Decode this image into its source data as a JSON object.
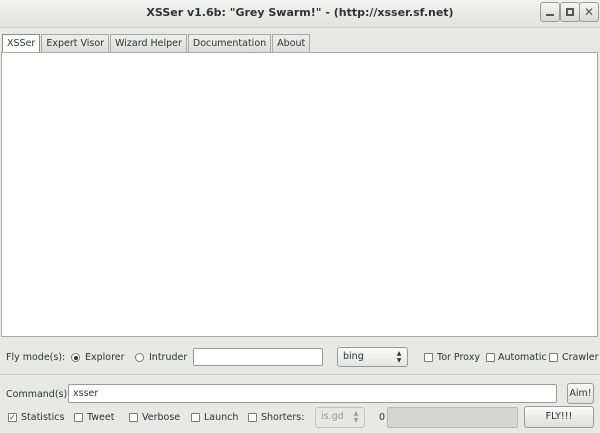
{
  "window": {
    "title": "XSSer v1.6b: \"Grey Swarm!\" - (http://xsser.sf.net)"
  },
  "tabs": [
    {
      "label": "XSSer",
      "active": true
    },
    {
      "label": "Expert Visor"
    },
    {
      "label": "Wizard Helper"
    },
    {
      "label": "Documentation"
    },
    {
      "label": "About"
    }
  ],
  "fly_mode": {
    "label": "Fly mode(s):",
    "explorer": {
      "label": "Explorer",
      "selected": true
    },
    "intruder": {
      "label": "Intruder",
      "selected": false
    },
    "target_value": "",
    "engine": "bing",
    "tor_proxy": "Tor Proxy",
    "automatic": "Automatic",
    "crawler": "Crawler"
  },
  "command": {
    "label": "Command(s):",
    "value": "xsser",
    "aim_button": "Aim!"
  },
  "options": {
    "statistics": {
      "label": "Statistics",
      "checked": true
    },
    "tweet": {
      "label": "Tweet",
      "checked": false
    },
    "verbose": {
      "label": "Verbose",
      "checked": false
    },
    "launch": {
      "label": "Launch",
      "checked": false
    },
    "shorters": {
      "label": "Shorters:",
      "checked": false
    },
    "shortener": "is.gd",
    "counter": "0",
    "fly_button": "FLY!!!"
  },
  "icons": {
    "minimize": "minimize-icon",
    "maximize": "maximize-icon",
    "close": "close-icon",
    "combo": "chevron-updown-icon"
  }
}
